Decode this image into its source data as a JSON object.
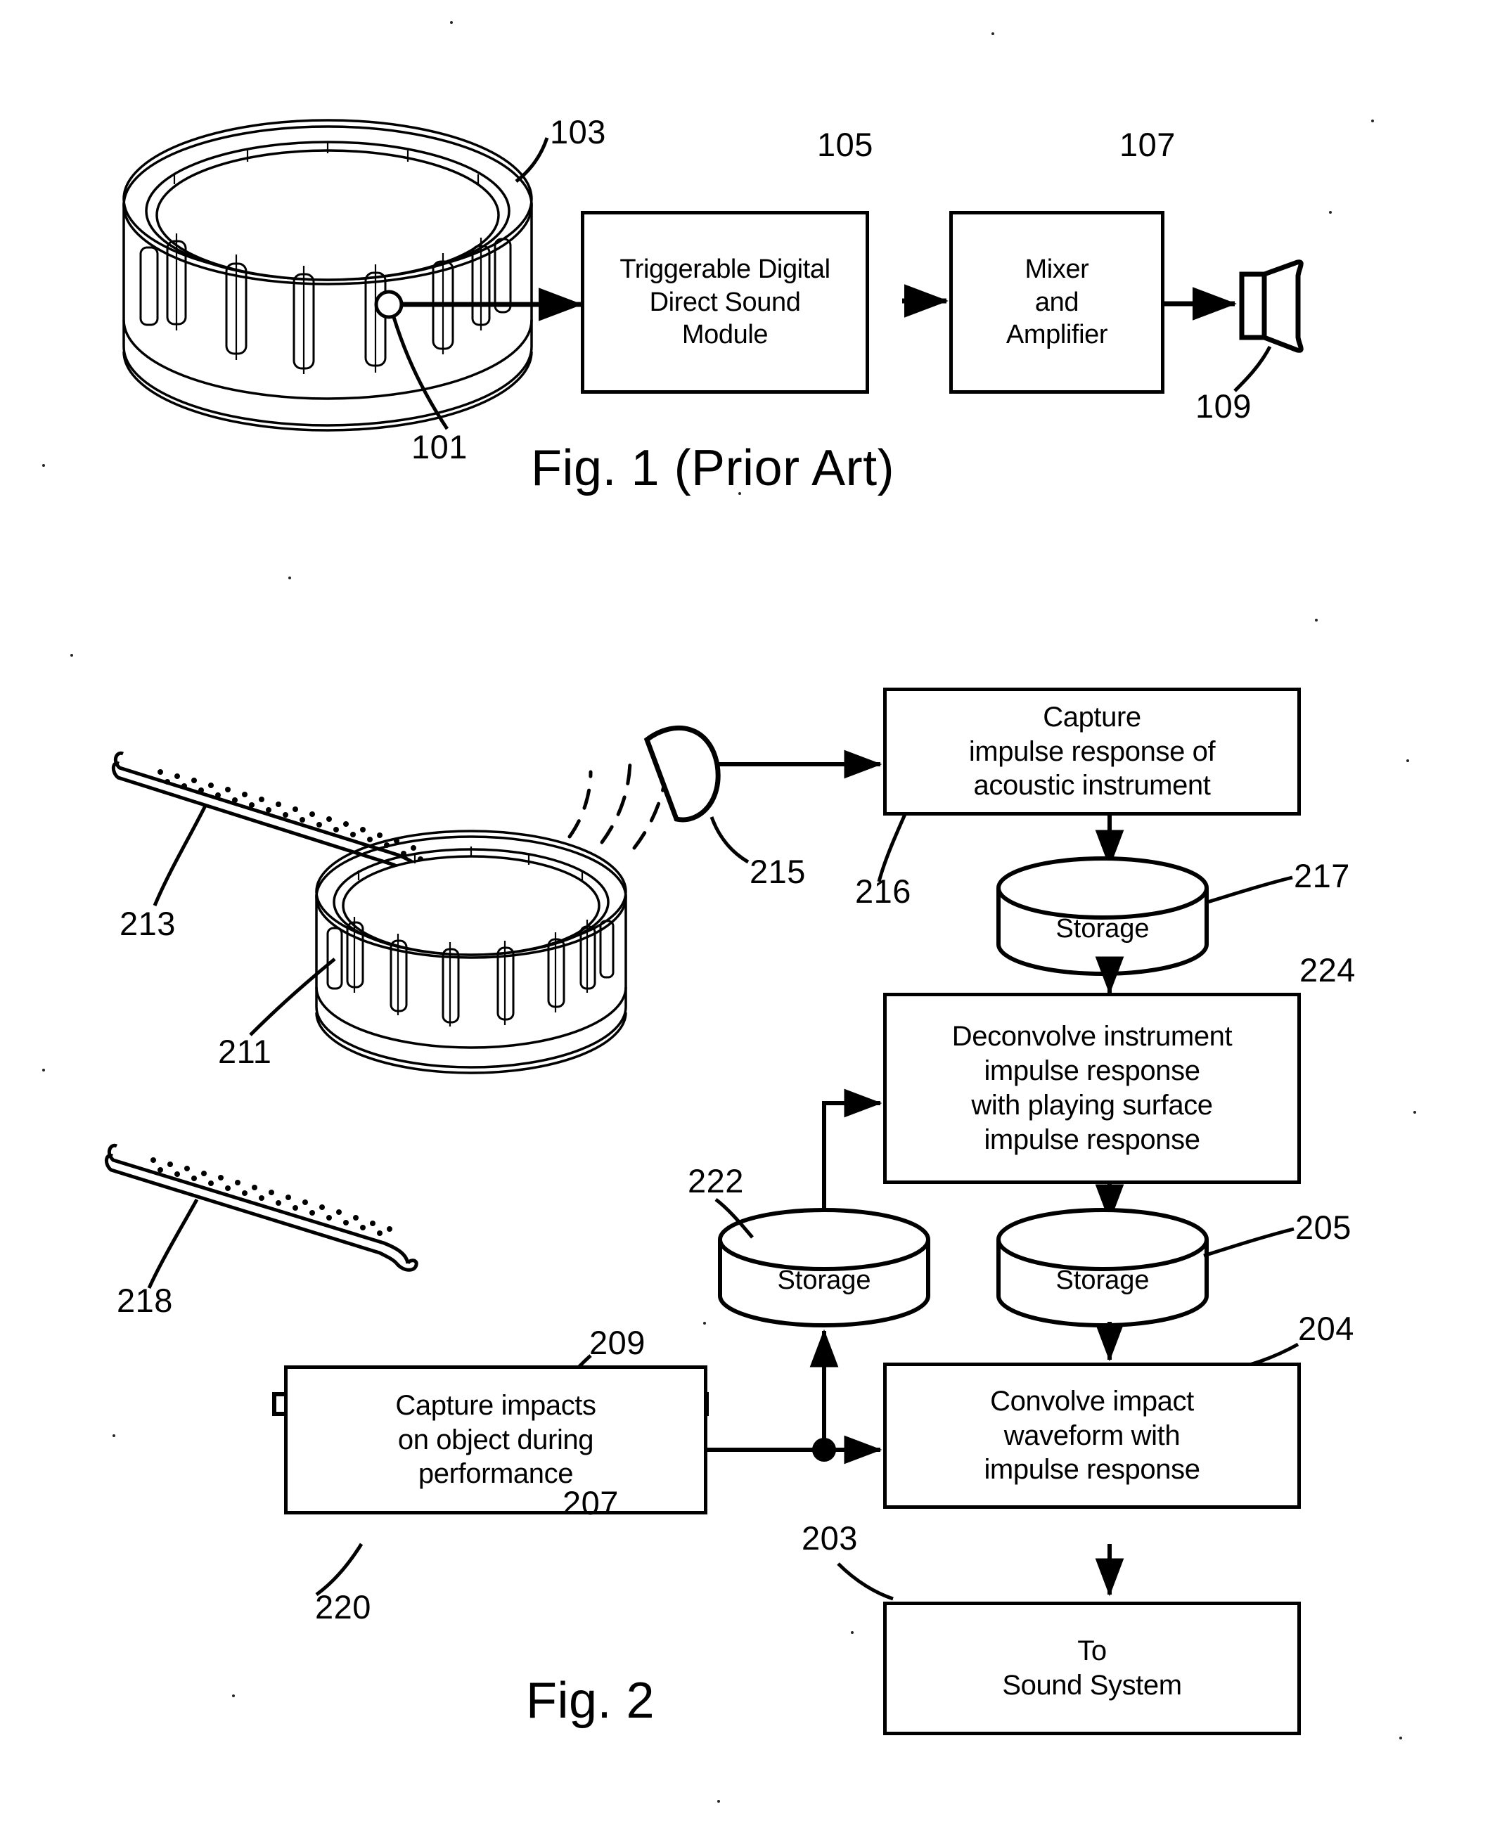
{
  "document": {
    "type": "patent-drawing-sheet",
    "background_color": "#ffffff",
    "ink_color": "#000000"
  },
  "figures": [
    {
      "id": "fig1",
      "caption": "Fig. 1 (Prior Art)",
      "blocks": [
        {
          "key": "trigger_module",
          "label": "Triggerable Digital\nDirect Sound\nModule",
          "ref": "105"
        },
        {
          "key": "mixer_amp",
          "label": "Mixer\nand\nAmplifier",
          "ref": "107"
        }
      ],
      "pictorials": [
        {
          "key": "drum",
          "name": "acoustic-drum",
          "ref": "103"
        },
        {
          "key": "trigger_pickup",
          "name": "trigger-pickup",
          "ref": "101"
        },
        {
          "key": "loudspeaker",
          "name": "loudspeaker",
          "ref": "109"
        }
      ],
      "ref_numbers": [
        "103",
        "105",
        "107",
        "109",
        "101"
      ]
    },
    {
      "id": "fig2",
      "caption": "Fig. 2",
      "blocks": [
        {
          "key": "capture_ir",
          "label": "Capture\nimpulse response of\nacoustic instrument",
          "ref": "216"
        },
        {
          "key": "deconvolve",
          "label": "Deconvolve instrument\nimpulse response\nwith playing surface\nimpulse response",
          "ref": "224"
        },
        {
          "key": "capture_impacts",
          "label": "Capture impacts\non object during\nperformance",
          "ref": "220"
        },
        {
          "key": "convolve",
          "label": "Convolve impact\nwaveform with\nimpulse response",
          "ref": "204"
        },
        {
          "key": "to_sound_system",
          "label": "To\nSound System",
          "ref": "203"
        }
      ],
      "storages": [
        {
          "key": "storage_217",
          "label": "Storage",
          "ref": "217"
        },
        {
          "key": "storage_222",
          "label": "Storage",
          "ref": "222"
        },
        {
          "key": "storage_205",
          "label": "Storage",
          "ref": "205"
        }
      ],
      "pictorials": [
        {
          "key": "drumstick_acoustic",
          "name": "drumstick",
          "ref": "213"
        },
        {
          "key": "drum_acoustic",
          "name": "acoustic-drum",
          "ref": "211"
        },
        {
          "key": "microphone",
          "name": "microphone",
          "ref": "215"
        },
        {
          "key": "drumstick_pad",
          "name": "drumstick",
          "ref": "218"
        },
        {
          "key": "playing_surface",
          "name": "playing-surface",
          "ref": "209"
        },
        {
          "key": "impact_sensor",
          "name": "impact-sensor",
          "ref": "207"
        }
      ],
      "ref_numbers": [
        "213",
        "211",
        "215",
        "216",
        "217",
        "224",
        "205",
        "204",
        "203",
        "218",
        "209",
        "222",
        "207",
        "220"
      ]
    }
  ],
  "fig1": {
    "caption": "Fig. 1 (Prior Art)",
    "trigger_module_label": "Triggerable Digital\nDirect Sound\nModule",
    "mixer_amp_label": "Mixer\nand\nAmplifier",
    "ref_103": "103",
    "ref_105": "105",
    "ref_107": "107",
    "ref_109": "109",
    "ref_101": "101"
  },
  "fig2": {
    "caption": "Fig. 2",
    "capture_ir_label": "Capture\nimpulse response of\nacoustic instrument",
    "deconvolve_label": "Deconvolve instrument\nimpulse response\nwith playing surface\nimpulse response",
    "capture_impacts_label": "Capture impacts\non object during\nperformance",
    "convolve_label": "Convolve impact\nwaveform with\nimpulse response",
    "to_sound_system_label": "To\nSound System",
    "storage_label": "Storage",
    "ref_213": "213",
    "ref_211": "211",
    "ref_215": "215",
    "ref_216": "216",
    "ref_217": "217",
    "ref_224": "224",
    "ref_205": "205",
    "ref_204": "204",
    "ref_203": "203",
    "ref_218": "218",
    "ref_209": "209",
    "ref_222": "222",
    "ref_207": "207",
    "ref_220": "220"
  }
}
